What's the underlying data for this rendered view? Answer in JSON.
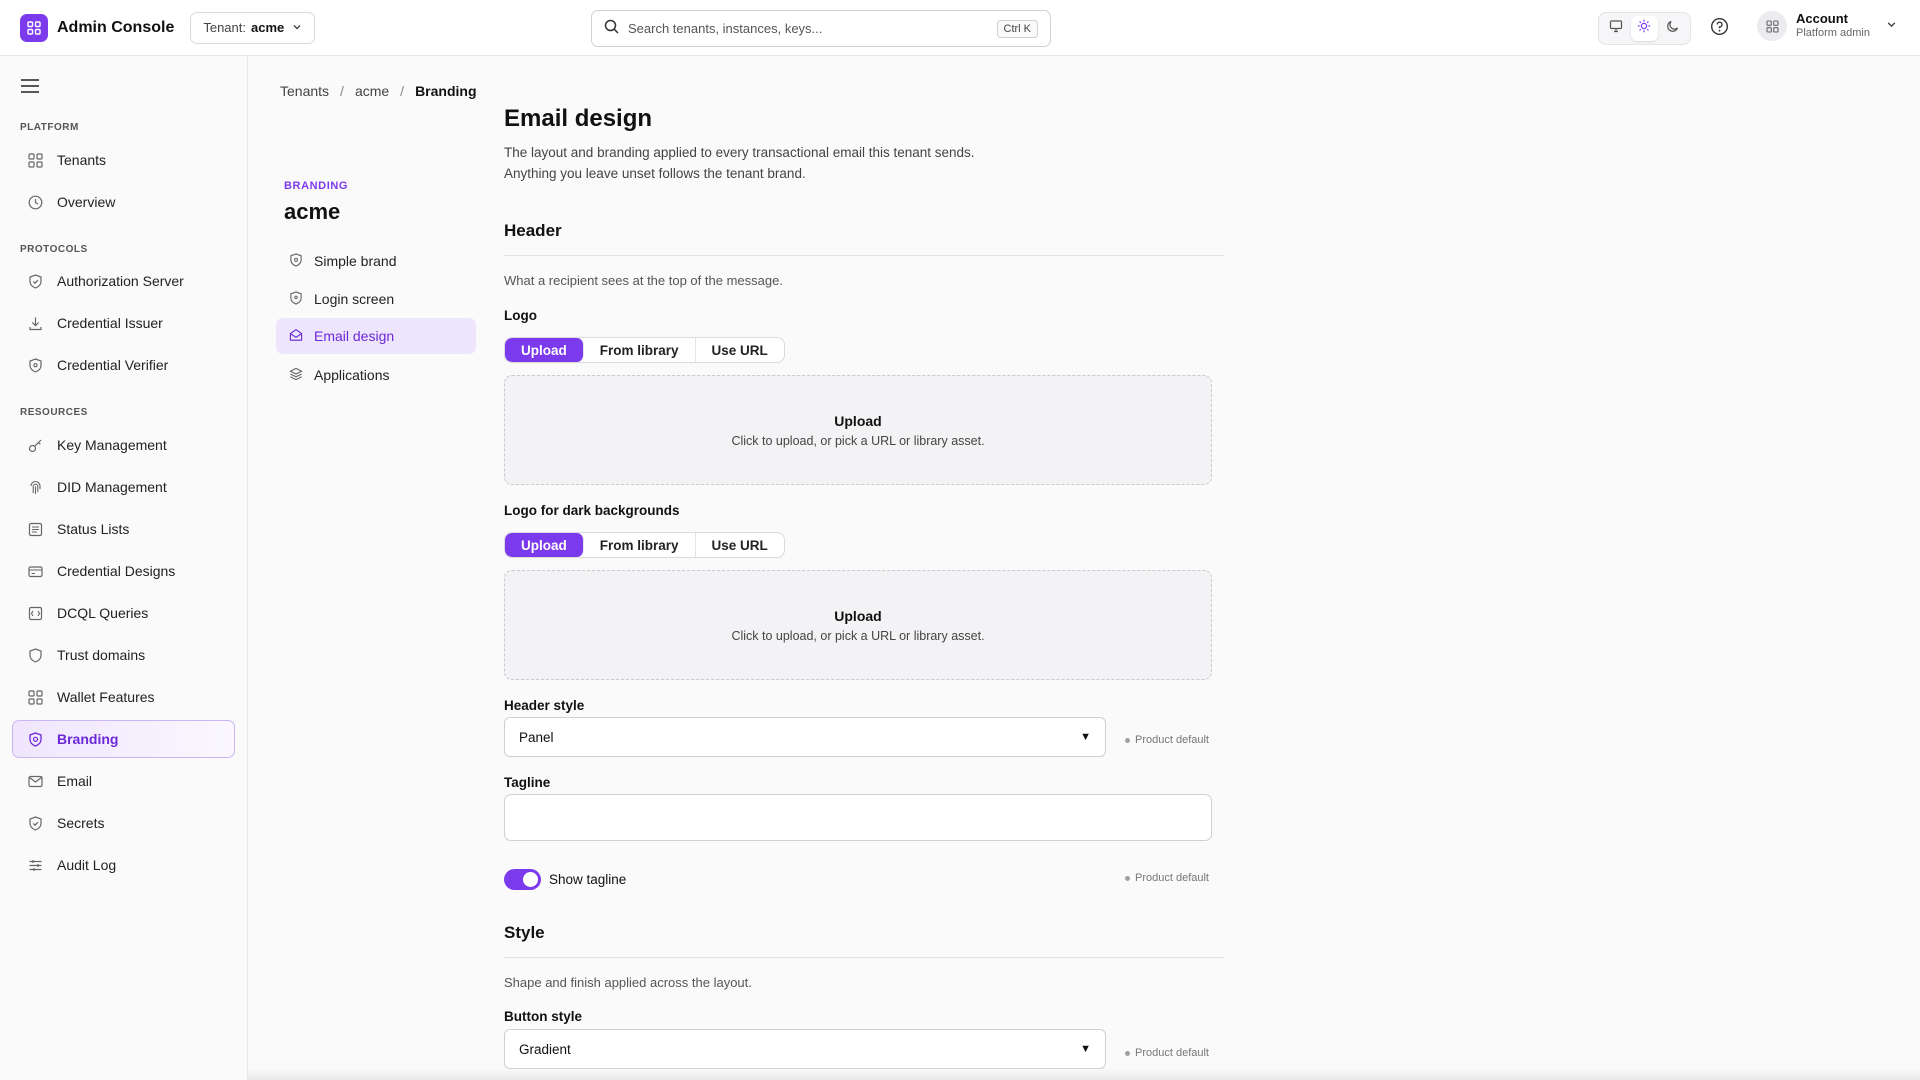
{
  "app": {
    "name": "Admin Console"
  },
  "tenant_selector": {
    "label": "Tenant:",
    "value": "acme"
  },
  "search": {
    "placeholder": "Search tenants, instances, keys...",
    "shortcut": "Ctrl K"
  },
  "account": {
    "name": "Account",
    "role": "Platform admin"
  },
  "theme": {
    "options": [
      "monitor-icon",
      "sun-icon",
      "moon-icon"
    ],
    "selected": "light"
  },
  "sidebar": {
    "sections": [
      {
        "title": "PLATFORM",
        "items": [
          {
            "label": "Tenants",
            "icon": "grid-icon"
          },
          {
            "label": "Overview",
            "icon": "clock-icon"
          }
        ]
      },
      {
        "title": "PROTOCOLS",
        "items": [
          {
            "label": "Authorization Server",
            "icon": "shield-icon"
          },
          {
            "label": "Credential Issuer",
            "icon": "download-icon"
          },
          {
            "label": "Credential Verifier",
            "icon": "shield-icon"
          }
        ]
      },
      {
        "title": "RESOURCES",
        "items": [
          {
            "label": "Key Management",
            "icon": "key-icon"
          },
          {
            "label": "DID Management",
            "icon": "fingerprint-icon"
          },
          {
            "label": "Status Lists",
            "icon": "list-icon"
          },
          {
            "label": "Credential Designs",
            "icon": "card-icon"
          },
          {
            "label": "DCQL Queries",
            "icon": "query-icon"
          },
          {
            "label": "Trust domains",
            "icon": "shield-icon"
          },
          {
            "label": "Wallet Features",
            "icon": "grid-icon"
          },
          {
            "label": "Branding",
            "icon": "badge-icon",
            "active": true
          },
          {
            "label": "Email",
            "icon": "mail-icon"
          },
          {
            "label": "Secrets",
            "icon": "shield-icon"
          },
          {
            "label": "Audit Log",
            "icon": "sliders-icon"
          }
        ]
      }
    ]
  },
  "breadcrumb": [
    "Tenants",
    "acme",
    "Branding"
  ],
  "subnav": {
    "kicker": "BRANDING",
    "title": "acme",
    "items": [
      {
        "label": "Simple brand",
        "icon": "shield-icon"
      },
      {
        "label": "Login screen",
        "icon": "shield-icon"
      },
      {
        "label": "Email design",
        "icon": "mail-open-icon",
        "active": true
      },
      {
        "label": "Applications",
        "icon": "layers-icon"
      }
    ]
  },
  "page": {
    "title": "Email design",
    "description_line1": "The layout and branding applied to every transactional email this tenant sends.",
    "description_line2": "Anything you leave unset follows the tenant brand."
  },
  "header_section": {
    "heading": "Header",
    "description": "What a recipient sees at the top of the message.",
    "logo": {
      "label": "Logo",
      "options": [
        "Upload",
        "From library",
        "Use URL"
      ],
      "selected": "Upload",
      "dropzone_title": "Upload",
      "dropzone_hint": "Click to upload, or pick a URL or library asset."
    },
    "logo_dark": {
      "label": "Logo for dark backgrounds",
      "options": [
        "Upload",
        "From library",
        "Use URL"
      ],
      "selected": "Upload",
      "dropzone_title": "Upload",
      "dropzone_hint": "Click to upload, or pick a URL or library asset."
    },
    "header_style": {
      "label": "Header style",
      "value": "Panel",
      "badge": "Product default"
    },
    "tagline": {
      "label": "Tagline",
      "value": ""
    },
    "show_tagline": {
      "label": "Show tagline",
      "on": true,
      "badge": "Product default"
    }
  },
  "style_section": {
    "heading": "Style",
    "description": "Shape and finish applied across the layout.",
    "button_style": {
      "label": "Button style",
      "value": "Gradient",
      "badge": "Product default"
    }
  },
  "colors": {
    "accent": "#7c3aed",
    "accent_soft": "#ede5fc"
  }
}
